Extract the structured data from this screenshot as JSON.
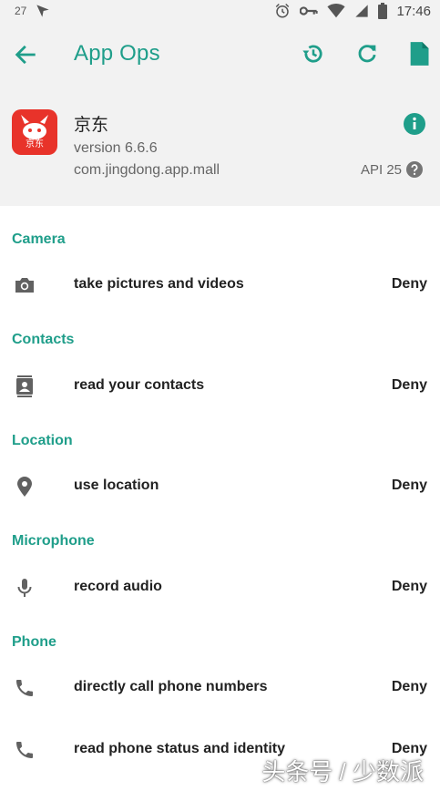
{
  "status_bar": {
    "notification_count": "27",
    "time": "17:46",
    "icons": [
      "navigation-icon",
      "alarm-icon",
      "key-icon",
      "wifi-icon",
      "no-signal-icon",
      "battery-icon"
    ]
  },
  "app_bar": {
    "title": "App Ops",
    "actions": [
      "history-icon",
      "refresh-icon",
      "file-icon"
    ]
  },
  "app_info": {
    "icon_text": "京东",
    "name": "京东",
    "version": "version 6.6.6",
    "package": "com.jingdong.app.mall",
    "api": "API 25"
  },
  "sections": [
    {
      "title": "Camera",
      "items": [
        {
          "icon": "camera-icon",
          "label": "take pictures and videos",
          "mode": "Deny"
        }
      ]
    },
    {
      "title": "Contacts",
      "items": [
        {
          "icon": "contacts-icon",
          "label": "read your contacts",
          "mode": "Deny"
        }
      ]
    },
    {
      "title": "Location",
      "items": [
        {
          "icon": "location-pin-icon",
          "label": "use location",
          "mode": "Deny"
        }
      ]
    },
    {
      "title": "Microphone",
      "items": [
        {
          "icon": "microphone-icon",
          "label": "record audio",
          "mode": "Deny"
        }
      ]
    },
    {
      "title": "Phone",
      "items": [
        {
          "icon": "phone-icon",
          "label": "directly call phone numbers",
          "mode": "Deny"
        },
        {
          "icon": "phone-icon",
          "label": "read phone status and identity",
          "mode": "Deny"
        }
      ]
    }
  ],
  "watermark": "头条号 / 少数派",
  "colors": {
    "accent": "#1f9e8a",
    "header_bg": "#f2f2f2",
    "app_icon_bg": "#e8332a"
  }
}
